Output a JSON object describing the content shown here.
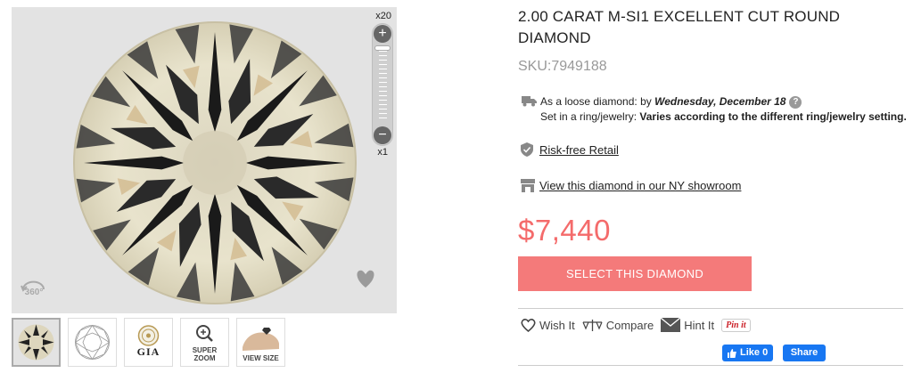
{
  "viewer": {
    "zoom_max_label": "x20",
    "zoom_min_label": "x1",
    "zoom_plus": "+",
    "zoom_minus": "−",
    "rotate_label": "360°"
  },
  "thumbnails": [
    {
      "name": "diamond-photo",
      "label": ""
    },
    {
      "name": "diamond-diagram",
      "label": ""
    },
    {
      "name": "gia-certificate",
      "label": "GIA"
    },
    {
      "name": "super-zoom",
      "label_line1": "SUPER",
      "label_line2": "ZOOM"
    },
    {
      "name": "view-size",
      "label": "VIEW SIZE"
    }
  ],
  "product": {
    "title": "2.00 CARAT M-SI1 EXCELLENT CUT ROUND DIAMOND",
    "sku": "SKU:7949188",
    "ship_loose_prefix": "As a loose diamond: by ",
    "ship_loose_date": "Wednesday, December 18",
    "ship_ring_prefix": "Set in a ring/jewelry: ",
    "ship_ring_value": "Varies according to the different ring/jewelry setting.",
    "risk_free": "Risk-free Retail",
    "showroom": "View this diamond in our NY showroom",
    "price": "$7,440",
    "select_button": "SELECT THIS DIAMOND",
    "help_glyph": "?"
  },
  "actions": {
    "wish": "Wish It",
    "compare": "Compare",
    "hint": "Hint It",
    "pin": "Pin it"
  },
  "facebook": {
    "like": "Like 0",
    "share": "Share"
  },
  "colors": {
    "accent": "#f47a7a",
    "price": "#f46b6b",
    "facebook": "#1877f2"
  }
}
